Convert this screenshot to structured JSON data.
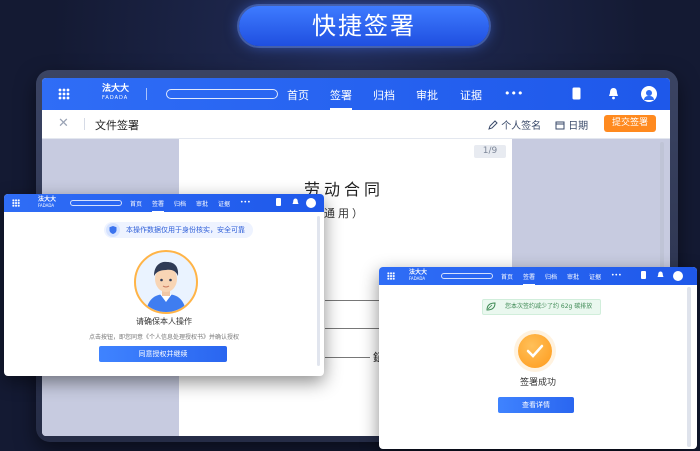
{
  "banner": {
    "title": "快捷签署"
  },
  "app": {
    "brand": "法大大",
    "brand_sub": "FADADA",
    "nav": [
      "首页",
      "签署",
      "归档",
      "审批",
      "证据"
    ],
    "active_nav": "签署",
    "more": "•••"
  },
  "toolbar": {
    "title": "文件签署",
    "personal_sign": "个人签名",
    "date": "日期",
    "submit": "提交签署"
  },
  "document": {
    "page_indicator": "1/9",
    "title": "劳动合同",
    "subtitle": "（通用）",
    "fragment": "鉦"
  },
  "auth_dialog": {
    "notice": "本操作数据仅用于身份核实，安全可靠",
    "caption": "请确保本人操作",
    "agreement": "点击按钮，即您同意《个人信息处理授权书》并确认授权",
    "button": "同意授权并继续"
  },
  "success_dialog": {
    "carbon_notice": "您本次签约减少了约 62g 碳排放",
    "status": "签署成功",
    "button": "查看详情"
  },
  "colors": {
    "primary": "#2f6df6",
    "accent_orange": "#ff8a1f",
    "background": "#141a33"
  }
}
